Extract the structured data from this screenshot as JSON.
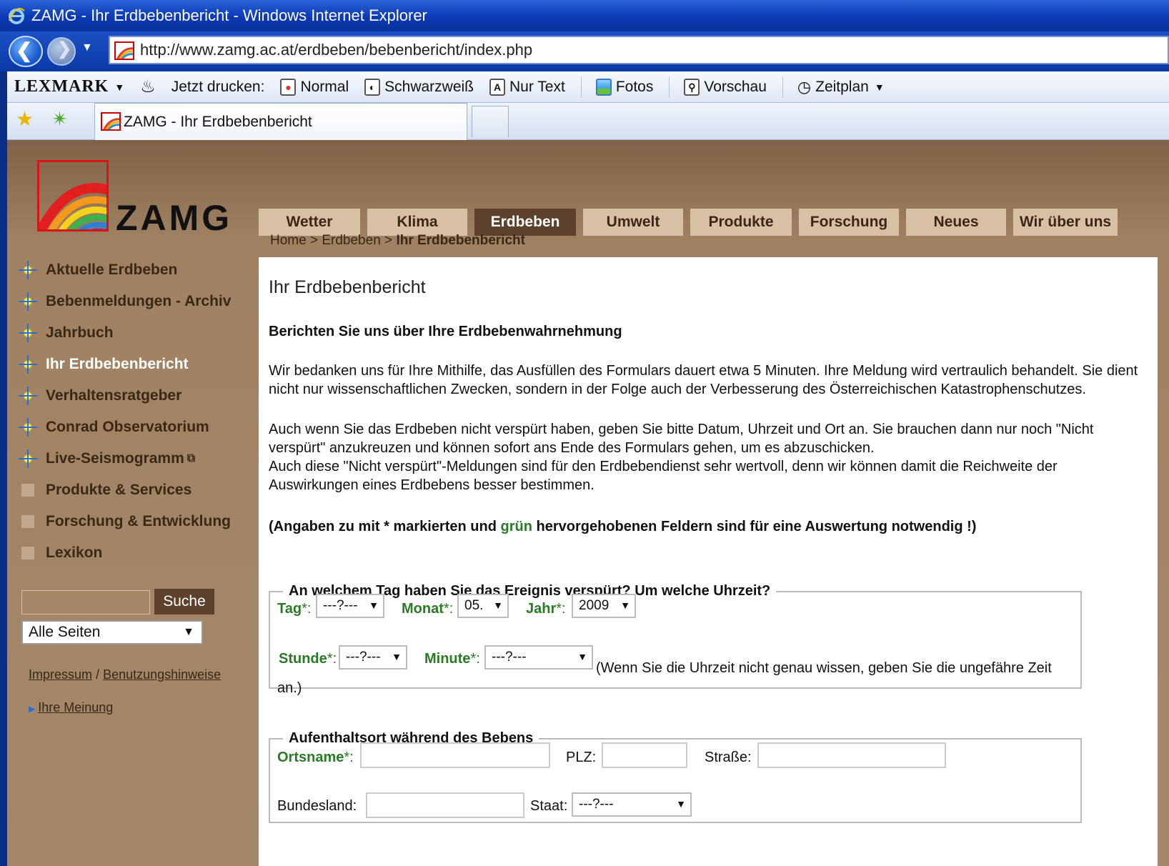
{
  "window": {
    "title": "ZAMG - Ihr Erdbebenbericht - Windows Internet Explorer"
  },
  "address": {
    "url": "http://www.zamg.ac.at/erdbeben/bebenbericht/index.php"
  },
  "commandbar": {
    "brand": "LEXMARK",
    "print_label": "Jetzt drucken:",
    "items": [
      "Normal",
      "Schwarzweiß",
      "Nur Text",
      "Fotos",
      "Vorschau",
      "Zeitplan"
    ]
  },
  "tab": {
    "title": "ZAMG - Ihr Erdbebenbericht"
  },
  "site": {
    "logo_text": "ZAMG",
    "mainnav": [
      "Wetter",
      "Klima",
      "Erdbeben",
      "Umwelt",
      "Produkte",
      "Forschung",
      "Neues",
      "Wir über uns"
    ],
    "mainnav_active": "Erdbeben",
    "breadcrumb": {
      "home": "Home",
      "sep": ">",
      "section": "Erdbeben",
      "current": "Ihr Erdbebenbericht"
    },
    "leftnav": [
      "Aktuelle Erdbeben",
      "Bebenmeldungen - Archiv",
      "Jahrbuch",
      "Ihr Erdbebenbericht",
      "Verhaltensratgeber",
      "Conrad Observatorium",
      "Live-Seismogramm",
      "Produkte & Services",
      "Forschung & Entwicklung",
      "Lexikon"
    ],
    "leftnav_active": "Ihr Erdbebenbericht",
    "search_button": "Suche",
    "search_scope": "Alle Seiten",
    "footer": {
      "impressum": "Impressum",
      "sep": "/",
      "hinweise": "Benutzungshinweise",
      "opinion": "Ihre Meinung"
    }
  },
  "content": {
    "title": "Ihr Erdbebenbericht",
    "subtitle": "Berichten Sie uns über Ihre Erdbebenwahrnehmung",
    "para1": "Wir bedanken uns für Ihre Mithilfe, das Ausfüllen des Formulars dauert etwa 5 Minuten. Ihre Meldung wird vertraulich behandelt. Sie dient nicht nur wissenschaftlichen Zwecken, sondern in der Folge auch der Verbesserung des Österreichischen Katastrophenschutzes.",
    "para2a": "Auch wenn Sie das Erdbeben nicht verspürt haben, geben Sie bitte Datum, Uhrzeit und Ort an. Sie brauchen dann nur noch \"Nicht verspürt\" anzukreuzen und können sofort ans Ende des Formulars gehen, um es abzuschicken.",
    "para2b": "Auch diese \"Nicht verspürt\"-Meldungen sind für den Erdbebendienst sehr wertvoll, denn wir können damit die Reichweite der Auswirkungen eines Erdbebens besser bestimmen.",
    "note_pre": "(Angaben zu mit * markierten und ",
    "note_green": "grün",
    "note_post": " hervorgehobenen Feldern sind für eine Auswertung notwendig !)"
  },
  "form_time": {
    "legend": "An welchem Tag haben Sie das Ereignis verspürt? Um welche Uhrzeit?",
    "day_label": "Tag",
    "day_value": "---?---",
    "month_label": "Monat",
    "month_value": "05.",
    "year_label": "Jahr",
    "year_value": "2009",
    "hour_label": "Stunde",
    "hour_value": "---?---",
    "minute_label": "Minute",
    "minute_value": "---?---",
    "hint": "(Wenn Sie die Uhrzeit nicht genau wissen, geben Sie die ungefähre Zeit an.)",
    "star": "*",
    "colon": ":"
  },
  "form_place": {
    "legend": "Aufenthaltsort während des Bebens",
    "ort_label": "Ortsname",
    "plz_label": "PLZ:",
    "street_label": "Straße:",
    "state_label": "Bundesland:",
    "country_label": "Staat:",
    "country_value": "---?---",
    "star": "*",
    "colon": ":"
  }
}
